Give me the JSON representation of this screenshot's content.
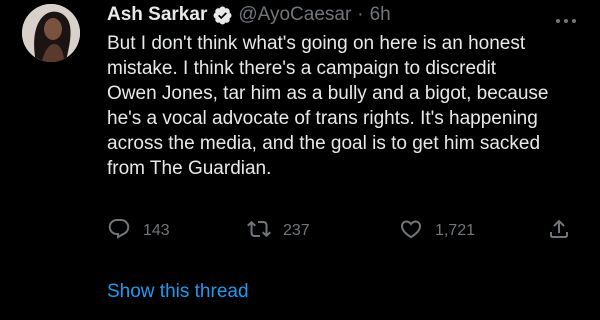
{
  "tweet": {
    "author_name": "Ash Sarkar",
    "handle": "@AyoCaesar",
    "separator": "·",
    "time": "6h",
    "text_lines": [
      "But I don't think what's going on here is an honest",
      "mistake. I think there's a campaign to discredit",
      "Owen Jones, tar him as a bully and a bigot, because",
      "he's a vocal advocate of trans rights. It's happening",
      "across the media, and the goal is to get him sacked",
      "from The Guardian."
    ]
  },
  "actions": {
    "reply_count": "143",
    "retweet_count": "237",
    "like_count": "1,721"
  },
  "thread_link": "Show this thread",
  "icons": {
    "avatar": "avatar",
    "verified": "verified-badge-icon",
    "more": "more-icon",
    "reply": "reply-icon",
    "retweet": "retweet-icon",
    "like": "heart-icon",
    "share": "share-icon"
  },
  "colors": {
    "background": "#000000",
    "text": "#e7e9ea",
    "secondary": "#71767b",
    "accent": "#1d9bf0"
  }
}
